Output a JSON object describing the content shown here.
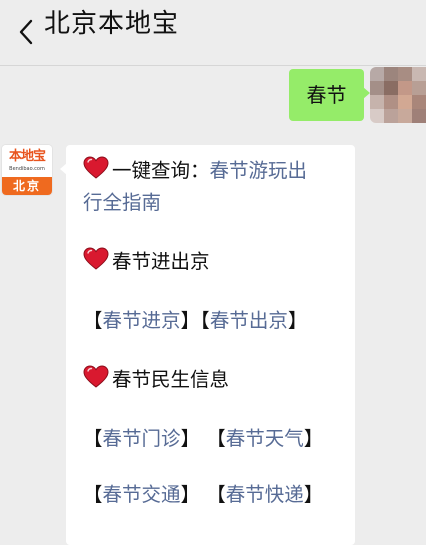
{
  "header": {
    "title": "北京本地宝"
  },
  "messages": {
    "outgoing": {
      "text": "春节"
    },
    "bot_avatar": {
      "logo_text": "本地宝",
      "logo_sub": "Bendibao.com",
      "logo_city": "北京"
    },
    "incoming": {
      "line1_prefix": "一键查询：",
      "line1_link_part1": "春节游玩出",
      "line2_link_part2": "行全指南",
      "section2_title": "春节进出京",
      "section2_links": [
        "春节进京",
        "春节出京"
      ],
      "section3_title": "春节民生信息",
      "section3_links_row1": [
        "春节门诊",
        "春节天气"
      ],
      "section3_links_row2": [
        "春节交通",
        "春节快递"
      ],
      "bracket_open": "【",
      "bracket_close": "】"
    }
  },
  "colors": {
    "background": "#ededed",
    "outgoing_bubble": "#95ec69",
    "link": "#576b95",
    "logo_orange": "#ef6a1f",
    "heart": "#d9192f"
  },
  "icons": {
    "back": "chevron-left-icon",
    "heart": "heart-icon"
  }
}
